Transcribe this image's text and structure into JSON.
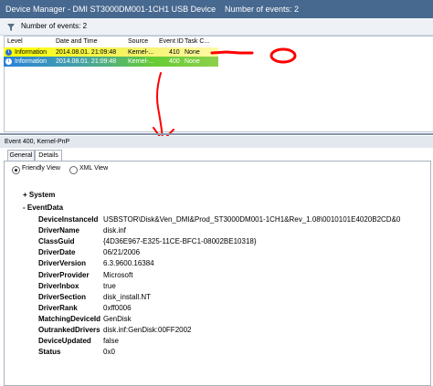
{
  "window": {
    "title": "Device Manager - DMI ST3000DM001-1CH1 USB Device",
    "events_count": "Number of events: 2"
  },
  "filter": {
    "count_label": "Number of events: 2"
  },
  "grid": {
    "columns": [
      "Level",
      "Date and Time",
      "Source",
      "Event ID",
      "Task C..."
    ],
    "rows": [
      {
        "level": "Information",
        "date": "2014.08.01. 21:09:48",
        "source": "Kernel-...",
        "event_id": "410",
        "task": "None"
      },
      {
        "level": "Information",
        "date": "2014.08.01. 21:09:48",
        "source": "Kernel-...",
        "event_id": "400",
        "task": "None"
      }
    ]
  },
  "details": {
    "title": "Event 400, Kernel-PnP",
    "tabs": [
      "General",
      "Details"
    ],
    "view_options": [
      "Friendly View",
      "XML View"
    ],
    "system_label": "+ System",
    "eventdata_label": "- EventData",
    "fields": [
      {
        "key": "DeviceInstanceId",
        "value": "USBSTOR\\Disk&Ven_DMI&Prod_ST3000DM001-1CH1&Rev_1.08\\0010101E4020B2CD&0"
      },
      {
        "key": "DriverName",
        "value": "disk.inf"
      },
      {
        "key": "ClassGuid",
        "value": "{4D36E967-E325-11CE-BFC1-08002BE10318}"
      },
      {
        "key": "DriverDate",
        "value": "06/21/2006"
      },
      {
        "key": "DriverVersion",
        "value": "6.3.9600.16384"
      },
      {
        "key": "DriverProvider",
        "value": "Microsoft"
      },
      {
        "key": "DriverInbox",
        "value": "true"
      },
      {
        "key": "DriverSection",
        "value": "disk_install.NT"
      },
      {
        "key": "DriverRank",
        "value": "0xff0006"
      },
      {
        "key": "MatchingDeviceId",
        "value": "GenDisk"
      },
      {
        "key": "OutrankedDrivers",
        "value": "disk.inf:GenDisk:00FF2002"
      },
      {
        "key": "DeviceUpdated",
        "value": "false"
      },
      {
        "key": "Status",
        "value": "0x0"
      }
    ]
  },
  "colors": {
    "titlebar": "#47688f",
    "row_highlight_yellow": "#ffff00",
    "row_selected_blue": "#2a82da",
    "row_selected_green": "#66cc33",
    "annotation_red": "#ff0000"
  },
  "icons": [
    "filter-icon",
    "info-icon",
    "radio-selected",
    "radio-unselected"
  ]
}
